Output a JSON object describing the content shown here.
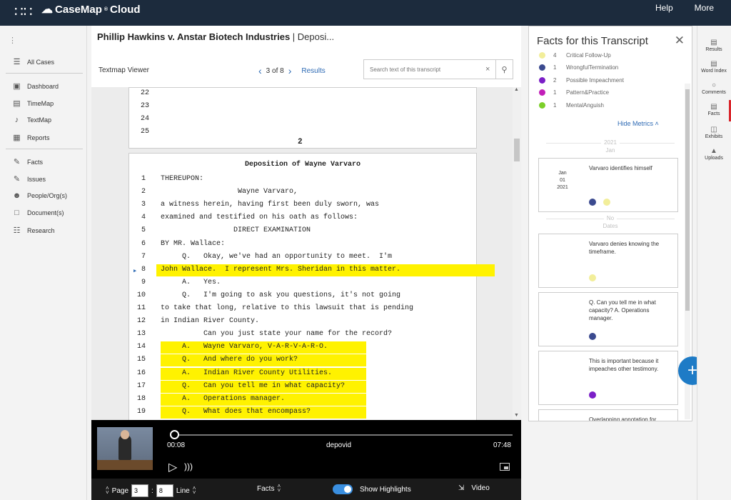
{
  "topbar": {
    "brand": "CaseMap",
    "brand_suffix": "Cloud",
    "help": "Help",
    "more": "More"
  },
  "leftnav": {
    "items": [
      "All Cases",
      "Dashboard",
      "TimeMap",
      "TextMap",
      "Reports",
      "Facts",
      "Issues",
      "People/Org(s)",
      "Document(s)",
      "Research"
    ]
  },
  "header": {
    "title": "Phillip Hawkins v. Anstar Biotech Industries",
    "subtitle": " | Deposi..."
  },
  "viewer": {
    "label": "Textmap Viewer",
    "pager": "3 of 8",
    "results": "Results",
    "search_placeholder": "Search text of this transcript"
  },
  "page1": {
    "lines": [
      "22",
      "23",
      "24",
      "25"
    ],
    "page_number": "2"
  },
  "page2": {
    "title": "Deposition of Wayne Varvaro",
    "lines": [
      {
        "n": "1",
        "t": "THEREUPON:"
      },
      {
        "n": "2",
        "t": "                  Wayne Varvaro,"
      },
      {
        "n": "3",
        "t": "a witness herein, having first been duly sworn, was"
      },
      {
        "n": "4",
        "t": "examined and testified on his oath as follows:"
      },
      {
        "n": "5",
        "t": "                 DIRECT EXAMINATION"
      },
      {
        "n": "6",
        "t": "BY MR. Wallace:"
      },
      {
        "n": "7",
        "t": "     Q.   Okay, we've had an opportunity to meet.  I'm"
      },
      {
        "n": "8",
        "t": "John Wallace.  I represent Mrs. Sheridan in this matter."
      },
      {
        "n": "9",
        "t": "     A.   Yes."
      },
      {
        "n": "10",
        "t": "     Q.   I'm going to ask you questions, it's not going"
      },
      {
        "n": "11",
        "t": "to take that long, relative to this lawsuit that is pending"
      },
      {
        "n": "12",
        "t": "in Indian River County."
      },
      {
        "n": "13",
        "t": "          Can you just state your name for the record?"
      },
      {
        "n": "14",
        "t": "     A.   Wayne Varvaro, V-A-R-V-A-R-O."
      },
      {
        "n": "15",
        "t": "     Q.   And where do you work?"
      },
      {
        "n": "16",
        "t": "     A.   Indian River County Utilities."
      },
      {
        "n": "17",
        "t": "     Q.   Can you tell me in what capacity?"
      },
      {
        "n": "18",
        "t": "     A.   Operations manager."
      },
      {
        "n": "19",
        "t": "     Q.   What does that encompass?"
      }
    ]
  },
  "video": {
    "current": "00:08",
    "name": "depovid",
    "end": "07:48",
    "progress": 0.0
  },
  "bottombar": {
    "page_label": "Page",
    "page_value": "3",
    "line_value": "8",
    "line_label": "Line",
    "facts_label": "Facts",
    "highlights_label": "Show Highlights",
    "video_label": "Video"
  },
  "facts_panel": {
    "title": "Facts for this Transcript",
    "legend": [
      {
        "count": "4",
        "label": "Critical Follow-Up",
        "color": "#f2ee9a"
      },
      {
        "count": "1",
        "label": "WrongfulTermination",
        "color": "#3b4a8f"
      },
      {
        "count": "2",
        "label": "Possible Impeachment",
        "color": "#7b1fc7"
      },
      {
        "count": "1",
        "label": "Pattern&Practice",
        "color": "#c21fb8"
      },
      {
        "count": "1",
        "label": "MentalAnguish",
        "color": "#7ccf2a"
      }
    ],
    "hide_metrics": "Hide Metrics",
    "sep1_year": "2021",
    "sep1_month": "Jan",
    "sep2_a": "No",
    "sep2_b": "Dates",
    "card1": {
      "m": "Jan",
      "d": "01",
      "y": "2021",
      "text": "Varvaro identifies himself"
    },
    "card2": {
      "text": "Varvaro denies knowing the timeframe."
    },
    "card3": {
      "text": "Q. Can you tell me in what capacity? A. Operations manager."
    },
    "card4": {
      "text": "This is important because it impeaches other testimony."
    },
    "card5": {
      "text": "Overlapping annotation for"
    }
  },
  "rightrail": [
    "Results",
    "Word Index",
    "Comments",
    "Facts",
    "Exhibits",
    "Uploads"
  ],
  "colors": {
    "highlight": "#fff200",
    "accent": "#2d6ab4",
    "topbar": "#1c2b3d"
  }
}
